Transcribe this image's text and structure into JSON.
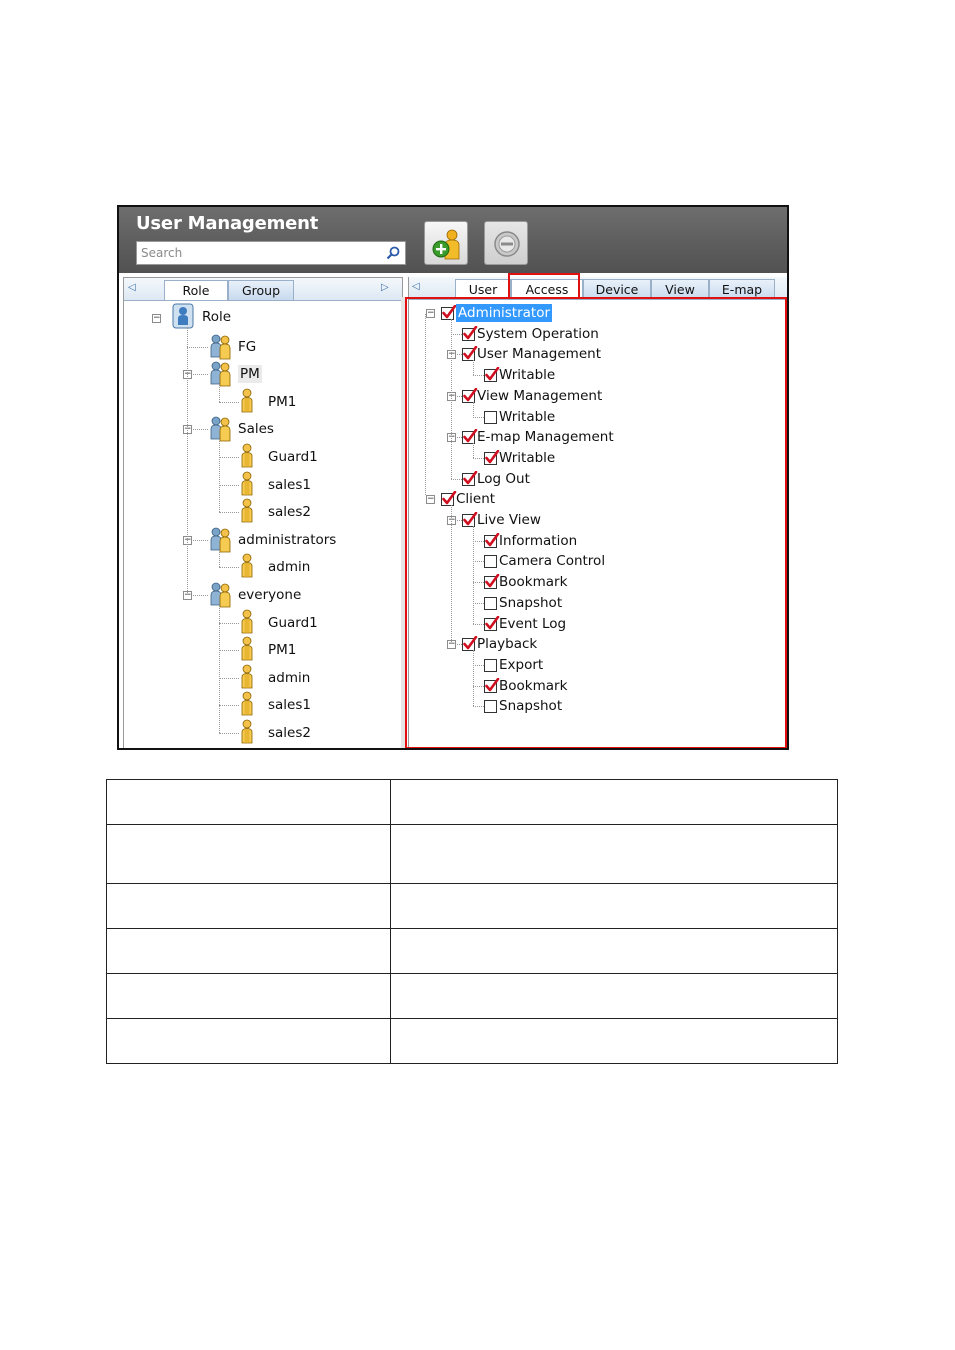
{
  "window": {
    "title": "User Management",
    "search": {
      "placeholder": "Search"
    },
    "toolbar": [
      {
        "name": "add-user-button",
        "icon": "add-user-icon"
      },
      {
        "name": "delete-button",
        "icon": "remove-icon"
      }
    ]
  },
  "left_panel": {
    "tabs": [
      {
        "label": "Role",
        "active": true
      },
      {
        "label": "Group",
        "active": false
      }
    ],
    "tree": {
      "label": "Role",
      "children": [
        {
          "label": "FG",
          "type": "group",
          "children": []
        },
        {
          "label": "PM",
          "type": "group",
          "highlighted": true,
          "children": [
            {
              "label": "PM1",
              "type": "user"
            }
          ]
        },
        {
          "label": "Sales",
          "type": "group",
          "children": [
            {
              "label": "Guard1",
              "type": "user"
            },
            {
              "label": "sales1",
              "type": "user"
            },
            {
              "label": "sales2",
              "type": "user"
            }
          ]
        },
        {
          "label": "administrators",
          "type": "group",
          "children": [
            {
              "label": "admin",
              "type": "user"
            }
          ]
        },
        {
          "label": "everyone",
          "type": "group",
          "children": [
            {
              "label": "Guard1",
              "type": "user"
            },
            {
              "label": "PM1",
              "type": "user"
            },
            {
              "label": "admin",
              "type": "user"
            },
            {
              "label": "sales1",
              "type": "user"
            },
            {
              "label": "sales2",
              "type": "user"
            }
          ]
        }
      ]
    }
  },
  "right_panel": {
    "tabs": [
      {
        "label": "User",
        "active": false
      },
      {
        "label": "Access",
        "active": true
      },
      {
        "label": "Device",
        "active": false
      },
      {
        "label": "View",
        "active": false
      },
      {
        "label": "E-map",
        "active": false
      }
    ],
    "tree": [
      {
        "label": "Administrator",
        "checked": true,
        "selected": true,
        "children": [
          {
            "label": "System Operation",
            "checked": true
          },
          {
            "label": "User Management",
            "checked": true,
            "children": [
              {
                "label": "Writable",
                "checked": true
              }
            ]
          },
          {
            "label": "View Management",
            "checked": true,
            "children": [
              {
                "label": "Writable",
                "checked": false
              }
            ]
          },
          {
            "label": "E-map Management",
            "checked": true,
            "children": [
              {
                "label": "Writable",
                "checked": true
              }
            ]
          },
          {
            "label": "Log Out",
            "checked": true
          }
        ]
      },
      {
        "label": "Client",
        "checked": true,
        "children": [
          {
            "label": "Live View",
            "checked": true,
            "children": [
              {
                "label": "Information",
                "checked": true
              },
              {
                "label": "Camera Control",
                "checked": false
              },
              {
                "label": "Bookmark",
                "checked": true
              },
              {
                "label": "Snapshot",
                "checked": false
              },
              {
                "label": "Event Log",
                "checked": true
              }
            ]
          },
          {
            "label": "Playback",
            "checked": true,
            "children": [
              {
                "label": "Export",
                "checked": false
              },
              {
                "label": "Bookmark",
                "checked": true
              },
              {
                "label": "Snapshot",
                "checked": false
              }
            ]
          }
        ]
      }
    ]
  },
  "colors": {
    "highlight_border": "#e01010",
    "checkmark": "#d01020",
    "selection": "#3399ff",
    "header": "#5c5c5c"
  },
  "empty_table": {
    "rows": 6,
    "cols": 2
  }
}
